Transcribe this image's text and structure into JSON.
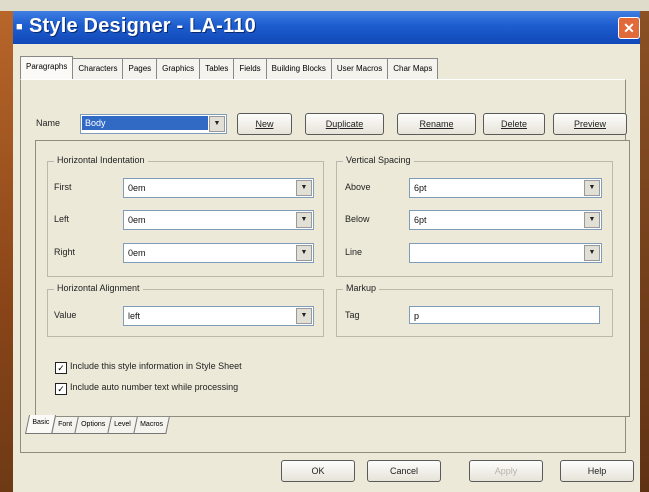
{
  "window": {
    "title": "Style Designer - LA-110",
    "close_glyph": "✕",
    "icon": "app-icon"
  },
  "top_tabs": [
    {
      "label": "Paragraphs",
      "active": true
    },
    {
      "label": "Characters"
    },
    {
      "label": "Pages"
    },
    {
      "label": "Graphics"
    },
    {
      "label": "Tables"
    },
    {
      "label": "Fields"
    },
    {
      "label": "Building Blocks"
    },
    {
      "label": "User Macros"
    },
    {
      "label": "Char Maps"
    }
  ],
  "name_row": {
    "label": "Name",
    "value": "Body",
    "buttons": {
      "new": "New",
      "duplicate": "Duplicate",
      "rename": "Rename",
      "delete": "Delete",
      "preview": "Preview"
    }
  },
  "horizontal_indentation": {
    "title": "Horizontal Indentation",
    "first_label": "First",
    "first_value": "0em",
    "left_label": "Left",
    "left_value": "0em",
    "right_label": "Right",
    "right_value": "0em"
  },
  "vertical_spacing": {
    "title": "Vertical Spacing",
    "above_label": "Above",
    "above_value": "6pt",
    "below_label": "Below",
    "below_value": "6pt",
    "line_label": "Line",
    "line_value": ""
  },
  "horizontal_alignment": {
    "title": "Horizontal Alignment",
    "value_label": "Value",
    "value": "left"
  },
  "markup": {
    "title": "Markup",
    "tag_label": "Tag",
    "tag_value": "p"
  },
  "checkboxes": {
    "style_sheet": {
      "label": "Include this style information in Style Sheet",
      "checked": true
    },
    "auto_number": {
      "label": "Include auto number text while processing",
      "checked": true
    }
  },
  "check_glyph": "✓",
  "arrow_glyph": "▼",
  "bottom_tabs": [
    {
      "label": "Basic",
      "active": true
    },
    {
      "label": "Font"
    },
    {
      "label": "Options"
    },
    {
      "label": "Level"
    },
    {
      "label": "Macros"
    }
  ],
  "dialog_buttons": {
    "ok": "OK",
    "cancel": "Cancel",
    "apply": "Apply",
    "help": "Help"
  }
}
